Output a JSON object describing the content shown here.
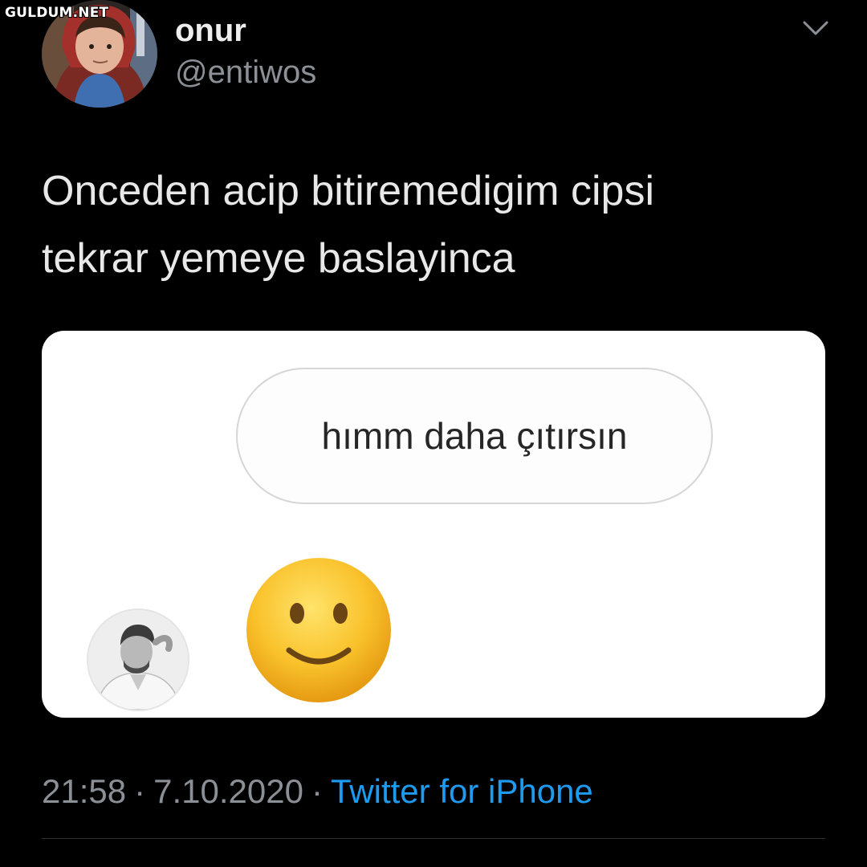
{
  "watermark": "GULDUM.NET",
  "tweet": {
    "display_name": "onur",
    "handle": "@entiwos",
    "text": "Onceden acip bitiremedigim cipsi\ntekrar yemeye baslayinca",
    "time": "21:58",
    "date": "7.10.2020",
    "separator": "·",
    "source": "Twitter for iPhone"
  },
  "media": {
    "message_text": "hımm daha çıtırsın",
    "reaction_emoji": "slightly-smiling-face"
  },
  "icons": {
    "more": "chevron-down-icon"
  },
  "colors": {
    "background": "#000000",
    "text": "#e7e9ea",
    "secondary": "#8b9096",
    "link": "#1d9bf0",
    "card": "#ffffff"
  }
}
